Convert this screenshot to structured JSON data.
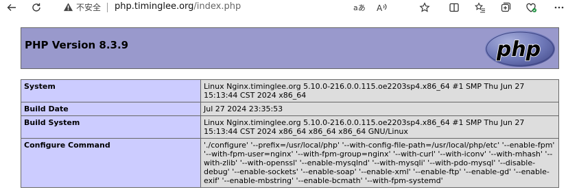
{
  "browser": {
    "security_label": "不安全",
    "url_domain": "php.timinglee.org",
    "url_path": "/index.php"
  },
  "php": {
    "version_title": "PHP Version 8.3.9",
    "logo_text": "php"
  },
  "info_rows": [
    {
      "key": "System",
      "value": "Linux Nginx.timinglee.org 5.10.0-216.0.0.115.oe2203sp4.x86_64 #1 SMP Thu Jun 27 15:13:44 CST 2024 x86_64"
    },
    {
      "key": "Build Date",
      "value": "Jul 27 2024 23:35:53"
    },
    {
      "key": "Build System",
      "value": "Linux Nginx.timinglee.org 5.10.0-216.0.0.115.oe2203sp4.x86_64 #1 SMP Thu Jun 27 15:13:44 CST 2024 x86_64 x86_64 x86_64 GNU/Linux"
    },
    {
      "key": "Configure Command",
      "value": "'./configure' '--prefix=/usr/local/php' '--with-config-file-path=/usr/local/php/etc' '--enable-fpm' '--with-fpm-user=nginx' '--with-fpm-group=nginx' '--with-curl' '--with-iconv' '--with-mhash' '--with-zlib' '--with-openssl' '--enable-mysqlnd' '--with-mysqli' '--with-pdo-mysql' '--disable-debug' '--enable-sockets' '--enable-soap' '--enable-xml' '--enable-ftp' '--enable-gd' '--enable-exif' '--enable-mbstring' '--enable-bcmath' '--with-fpm-systemd'"
    }
  ]
}
